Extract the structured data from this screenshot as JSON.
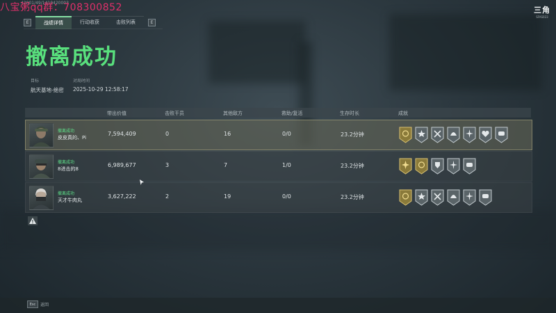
{
  "watermark": {
    "text": "八宝粥qq群：708300852",
    "small_text": "42001/49/1410420003"
  },
  "topbar": {
    "left_key": "E",
    "right_key": "E",
    "tabs": [
      {
        "label": "战绩详情",
        "active": true
      },
      {
        "label": "行动收获",
        "active": false
      },
      {
        "label": "击败列表",
        "active": false
      }
    ]
  },
  "logo": {
    "main": "三角",
    "sub": "SFAS023"
  },
  "title": "撤离成功",
  "info": {
    "target_label": "目标",
    "target_value": "航天基地-绝密",
    "time_label": "对局时间",
    "time_value": "2025-10-29 12:58:17"
  },
  "table": {
    "headers": [
      "带出价值",
      "击败干员",
      "其他敌方",
      "救助/复活",
      "生存时长",
      "成就"
    ],
    "rows": [
      {
        "status": "撤离成功",
        "name": "皮皮真的、Pi",
        "value": "7,594,409",
        "kills": "0",
        "others": "16",
        "revive": "0/0",
        "survival": "23.2分钟",
        "badges": [
          "gold-smile-badge",
          "star-paw-badge",
          "wrench-badge",
          "helmet-badge",
          "spark-badge",
          "heart-badge",
          "hand-badge"
        ]
      },
      {
        "status": "撤离成功",
        "name": "8进击的8",
        "value": "6,989,677",
        "kills": "3",
        "others": "7",
        "revive": "1/0",
        "survival": "23.2分钟",
        "badges": [
          "gold-sun-badge",
          "gold-smile-badge",
          "shield-badge",
          "spark-badge",
          "hand-badge"
        ]
      },
      {
        "status": "撤离成功",
        "name": "天才牛肉丸",
        "value": "3,627,222",
        "kills": "2",
        "others": "19",
        "revive": "0/0",
        "survival": "23.2分钟",
        "badges": [
          "gold-smile-badge",
          "star-paw-badge",
          "wrench-badge",
          "helmet-badge",
          "spark-badge",
          "hand-badge"
        ]
      }
    ]
  },
  "footer": {
    "esc_key": "Esc",
    "back_label": "返回"
  },
  "colors": {
    "accent_green": "#59e07d",
    "status_green": "#5fe08a",
    "highlight_row": "#c8be8c",
    "watermark": "#e0306a"
  }
}
